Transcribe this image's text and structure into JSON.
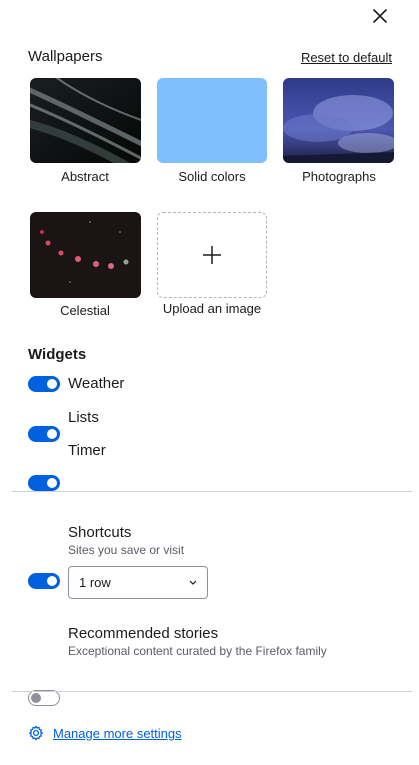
{
  "header": {
    "close_icon": "close-icon"
  },
  "wallpapers": {
    "title": "Wallpapers",
    "reset_label": "Reset to default",
    "tiles": [
      {
        "label": "Abstract"
      },
      {
        "label": "Solid colors",
        "color": "#80bfff"
      },
      {
        "label": "Photographs"
      },
      {
        "label": "Celestial"
      },
      {
        "label": "Upload an image"
      }
    ]
  },
  "widgets": {
    "title": "Widgets",
    "items": [
      {
        "label": "Weather",
        "enabled": true
      },
      {
        "label": "Lists",
        "enabled": true
      },
      {
        "label": "Timer",
        "enabled": true
      }
    ]
  },
  "shortcuts": {
    "label": "Shortcuts",
    "description": "Sites you save or visit",
    "enabled": true,
    "rows_selected": "1 row"
  },
  "stories": {
    "label": "Recommended stories",
    "description": "Exceptional content curated by the Firefox family",
    "enabled": false
  },
  "footer": {
    "manage_label": "Manage more settings"
  },
  "colors": {
    "accent": "#0061e0"
  }
}
